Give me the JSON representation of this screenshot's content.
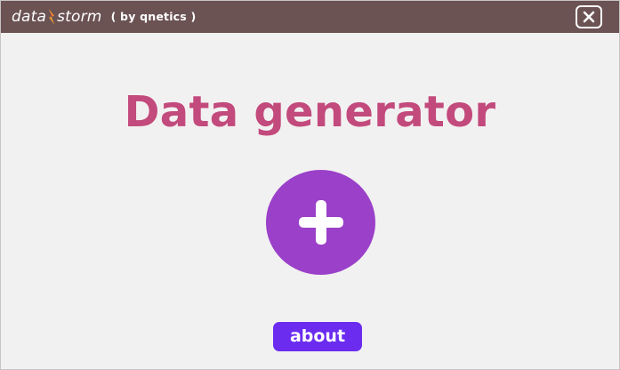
{
  "titlebar": {
    "logo_left": "data",
    "logo_right": "storm",
    "byline": "( by qnetics )",
    "close_icon": "close-icon"
  },
  "main": {
    "title": "Data generator",
    "add_icon": "plus-icon",
    "about_label": "about"
  },
  "colors": {
    "titlebar_bg": "#6b5253",
    "page_bg": "#f2f1f1",
    "title_text": "#c24a7c",
    "add_button": "#9b40c9",
    "about_button": "#6b2cf0",
    "logo_bolt": "#f0a030"
  }
}
